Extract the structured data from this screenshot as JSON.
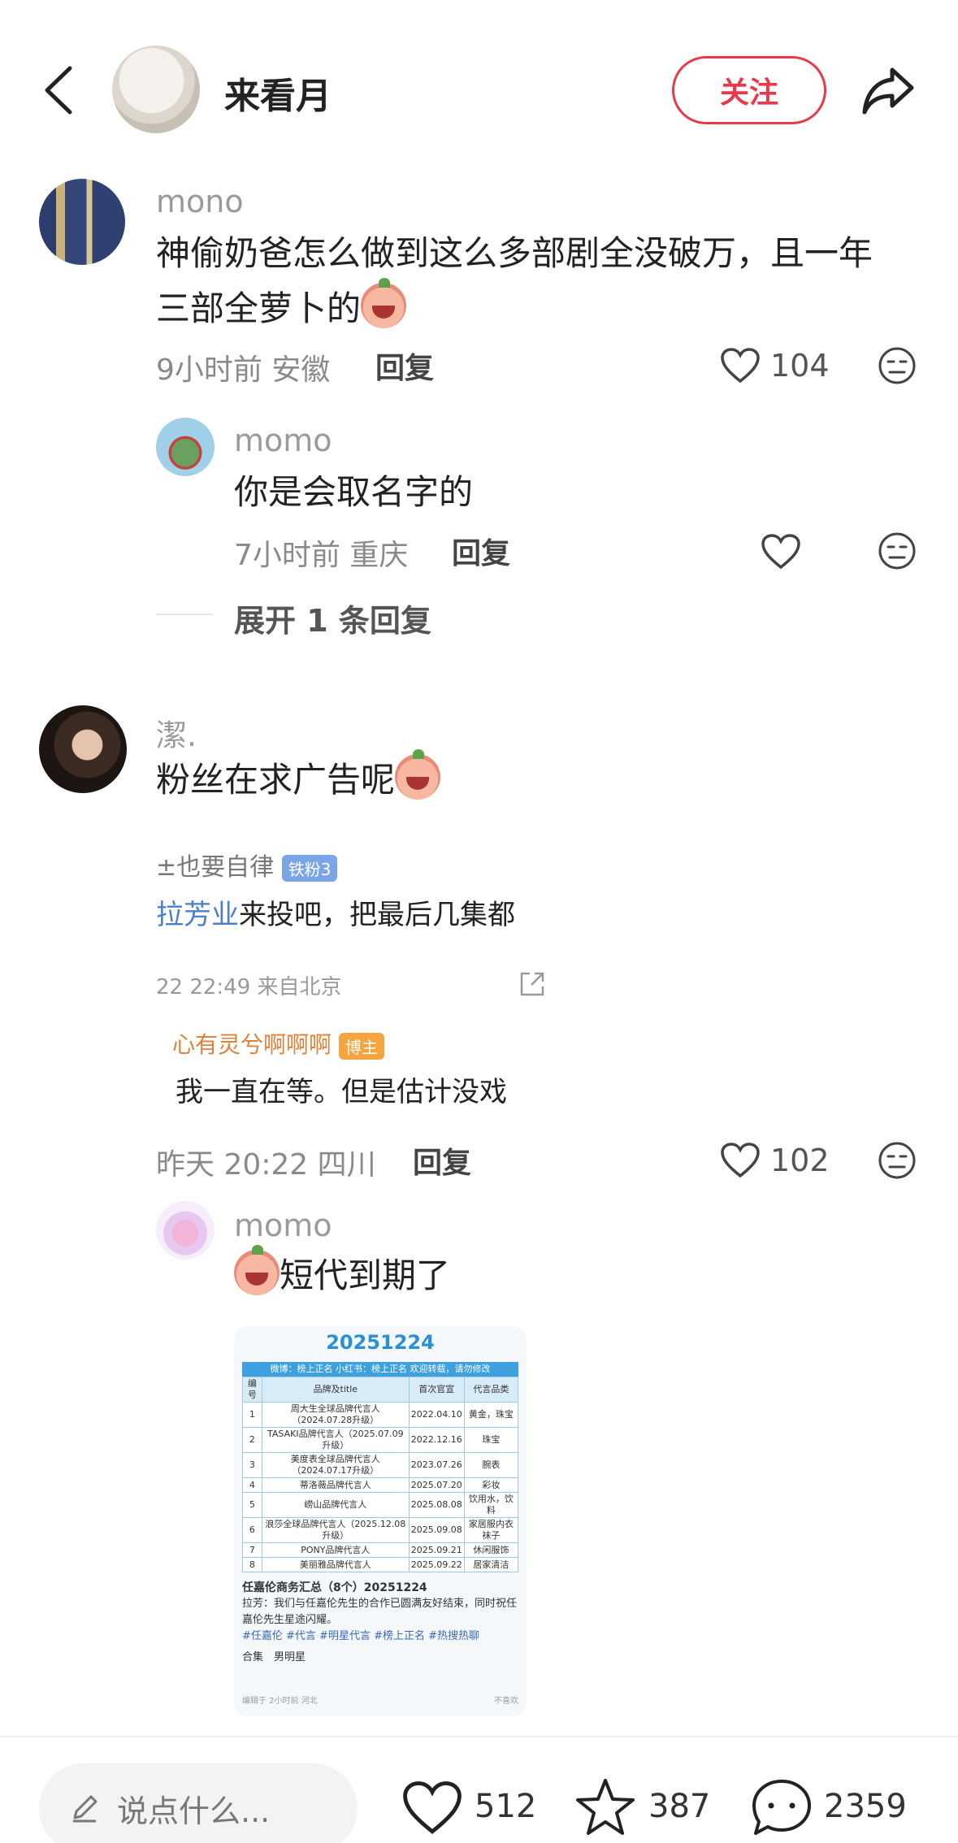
{
  "header": {
    "author_name": "来看月",
    "follow_label": "关注"
  },
  "comments": [
    {
      "user": "mono",
      "text_line1": "神偷奶爸怎么做到这么多部剧全没破万，且一年",
      "text_line2": "三部全萝卜的",
      "time": "9小时前",
      "location": "安徽",
      "reply_label": "回复",
      "likes": "104",
      "replies": [
        {
          "user": "momo",
          "text": "你是会取名字的",
          "time": "7小时前",
          "location": "重庆",
          "reply_label": "回复"
        }
      ],
      "expand_label": "展开 1 条回复"
    },
    {
      "user": "潔.",
      "text": "粉丝在求广告呢",
      "embed": {
        "line1_name": "±也要自律",
        "line1_badge": "铁粉3",
        "line2_highlight": "拉芳业",
        "line2_text": "来投吧，把最后几集都",
        "line3_time": "22 22:49",
        "line3_loc": "来自北京",
        "line4_name": "心有灵兮啊啊啊",
        "line4_badge": "博主",
        "line5_text": "我一直在等。但是估计没戏"
      },
      "time": "昨天 20:22",
      "location": "四川",
      "reply_label": "回复",
      "likes": "102",
      "replies": [
        {
          "user": "momo",
          "text": "短代到期了",
          "attachment": {
            "title": "20251224",
            "subtitle": "微博：榜上正名 小红书：榜上正名 欢迎转载，请勿修改",
            "headers": [
              "编号",
              "品牌及title",
              "首次官宣",
              "代言品类"
            ],
            "rows": [
              [
                "1",
                "周大生全球品牌代言人（2024.07.28升级）",
                "2022.04.10",
                "黄金，珠宝"
              ],
              [
                "2",
                "TASAKI品牌代言人（2025.07.09升级）",
                "2022.12.16",
                "珠宝"
              ],
              [
                "3",
                "美度表全球品牌代言人（2024.07.17升级）",
                "2023.07.26",
                "腕表"
              ],
              [
                "4",
                "蒂洛薇品牌代言人",
                "2025.07.20",
                "彩妆"
              ],
              [
                "5",
                "崂山品牌代言人",
                "2025.08.08",
                "饮用水，饮料"
              ],
              [
                "6",
                "浪莎全球品牌代言人（2025.12.08升级）",
                "2025.09.08",
                "家居服内衣袜子"
              ],
              [
                "7",
                "PONY品牌代言人",
                "2025.09.21",
                "休闲服饰"
              ],
              [
                "8",
                "美丽雅品牌代言人",
                "2025.09.22",
                "居家清洁"
              ]
            ],
            "caption_title": "任嘉伦商务汇总（8个）20251224",
            "caption_text": "拉芳：我们与任嘉伦先生的合作已圆满友好结束，同时祝任嘉伦先生星途闪耀。",
            "caption_tags": "#任嘉伦 #代言 #明星代言 #榜上正名 #热搜热聊",
            "collection": "合集　男明星",
            "footer_left": "编辑于 2小时前 河北",
            "footer_right": "不喜欢"
          }
        }
      ]
    }
  ],
  "bottom_bar": {
    "input_placeholder": "说点什么...",
    "like_count": "512",
    "star_count": "387",
    "comment_count": "2359"
  }
}
